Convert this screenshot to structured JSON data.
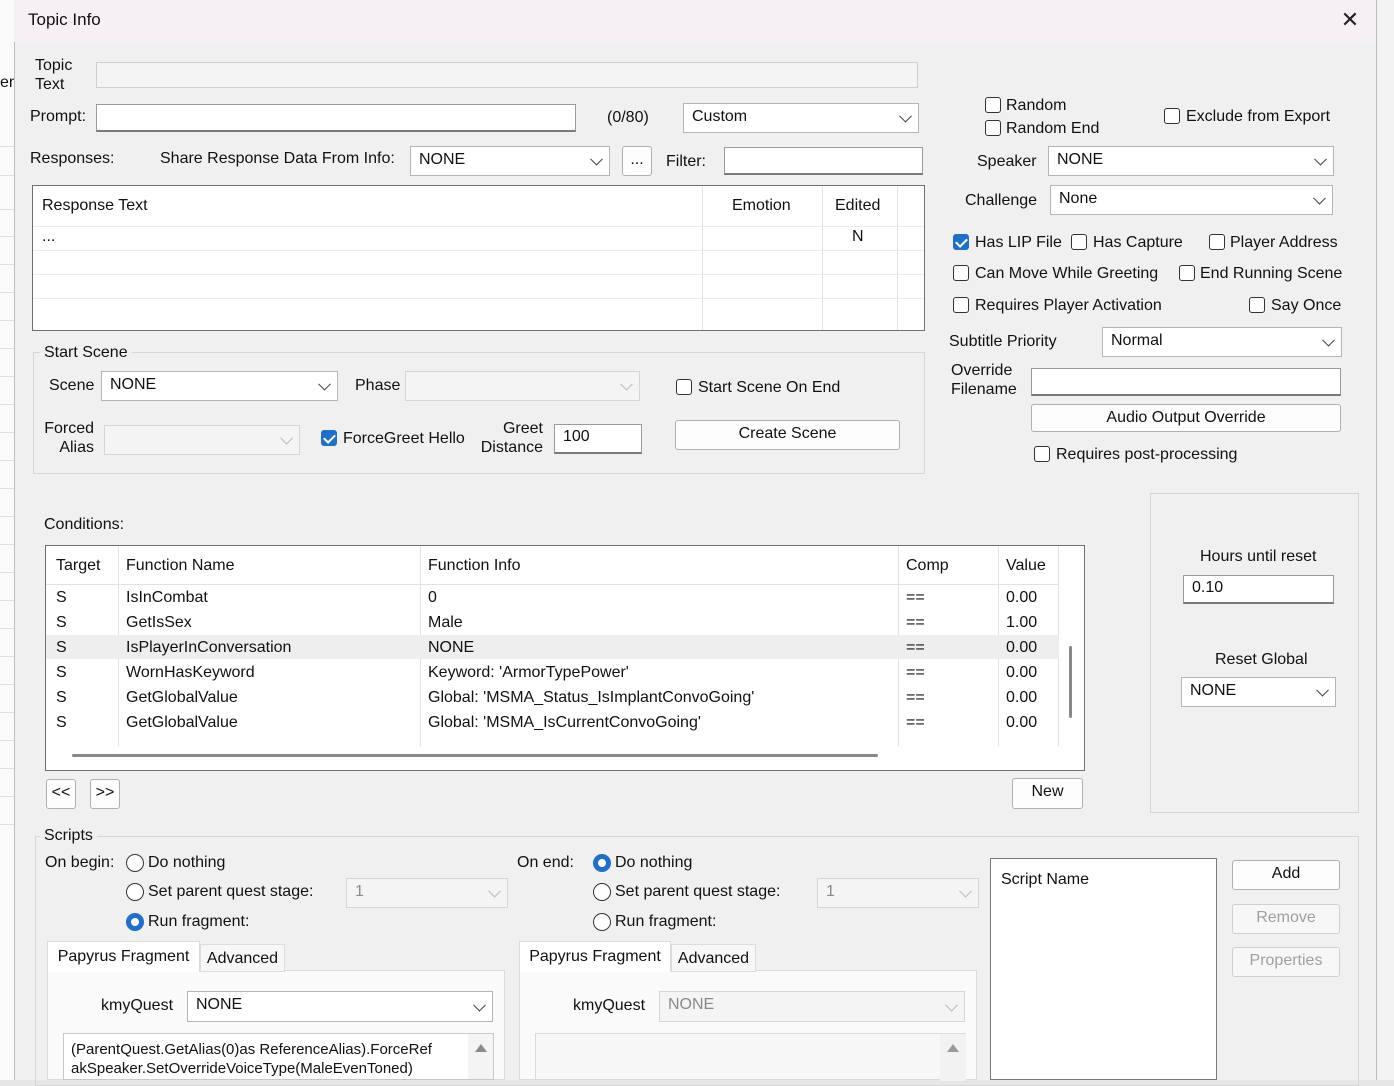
{
  "window": {
    "title": "Topic Info",
    "close_glyph": "✕"
  },
  "bg_sliver_text": "en",
  "topic": {
    "label_line1": "Topic",
    "label_line2": "Text",
    "value": ""
  },
  "prompt": {
    "label": "Prompt:",
    "value": "",
    "counter": "(0/80)",
    "type_value": "Custom"
  },
  "responses": {
    "label": "Responses:",
    "share_label": "Share Response Data From Info:",
    "share_value": "NONE",
    "ellipsis_button": "...",
    "filter_label": "Filter:",
    "filter_value": "",
    "columns": [
      "Response Text",
      "Emotion",
      "Edited"
    ],
    "rows": [
      {
        "text": "...",
        "emotion": "",
        "edited": "N"
      }
    ]
  },
  "flags": {
    "random": "Random",
    "random_end": "Random End",
    "exclude_from_export": "Exclude from Export",
    "speaker_label": "Speaker",
    "speaker_value": "NONE",
    "challenge_label": "Challenge",
    "challenge_value": "None",
    "has_lip_file": "Has LIP File",
    "has_capture": "Has Capture",
    "player_address": "Player Address",
    "can_move_while_greeting": "Can Move While Greeting",
    "end_running_scene": "End Running Scene",
    "requires_player_activation": "Requires Player Activation",
    "say_once": "Say Once",
    "subtitle_priority_label": "Subtitle Priority",
    "subtitle_priority_value": "Normal",
    "override_label_line1": "Override",
    "override_label_line2": "Filename",
    "override_value": "",
    "audio_output_override": "Audio Output Override",
    "requires_post_processing": "Requires post-processing"
  },
  "start_scene": {
    "group_label": "Start Scene",
    "scene_label": "Scene",
    "scene_value": "NONE",
    "phase_label": "Phase",
    "phase_value": "",
    "start_on_end": "Start Scene On End",
    "forced_label_line1": "Forced",
    "forced_label_line2": "Alias",
    "forced_value": "",
    "forcegreet_hello": "ForceGreet Hello",
    "greet_label_line1": "Greet",
    "greet_label_line2": "Distance",
    "greet_value": "100",
    "create_scene": "Create Scene"
  },
  "conditions": {
    "label": "Conditions:",
    "columns": [
      "Target",
      "Function Name",
      "Function Info",
      "Comp",
      "Value"
    ],
    "rows": [
      {
        "target": "S",
        "function": "IsInCombat",
        "info": "0",
        "comp": "==",
        "value": "0.00"
      },
      {
        "target": "S",
        "function": "GetIsSex",
        "info": "Male",
        "comp": "==",
        "value": "1.00"
      },
      {
        "target": "S",
        "function": "IsPlayerInConversation",
        "info": "NONE",
        "comp": "==",
        "value": "0.00"
      },
      {
        "target": "S",
        "function": "WornHasKeyword",
        "info": "Keyword: 'ArmorTypePower'",
        "comp": "==",
        "value": "0.00"
      },
      {
        "target": "S",
        "function": "GetGlobalValue",
        "info": "Global: 'MSMA_Status_IsImplantConvoGoing'",
        "comp": "==",
        "value": "0.00"
      },
      {
        "target": "S",
        "function": "GetGlobalValue",
        "info": "Global: 'MSMA_IsCurrentConvoGoing'",
        "comp": "==",
        "value": "0.00"
      }
    ],
    "prev_button": "<<",
    "next_button": ">>",
    "new_button": "New"
  },
  "reset": {
    "hours_label": "Hours until reset",
    "hours_value": "0.10",
    "global_label": "Reset Global",
    "global_value": "NONE"
  },
  "scripts": {
    "group_label": "Scripts",
    "on_begin": {
      "label": "On begin:",
      "do_nothing": "Do nothing",
      "set_stage": "Set parent quest stage:",
      "stage_value": "1",
      "run_fragment": "Run fragment:",
      "tab_papyrus": "Papyrus Fragment",
      "tab_advanced": "Advanced",
      "quest_label": "kmyQuest",
      "quest_value": "NONE",
      "code_line1": "(ParentQuest.GetAlias(0)as ReferenceAlias).ForceRef",
      "code_line2": "akSpeaker.SetOverrideVoiceType(MaleEvenToned)"
    },
    "on_end": {
      "label": "On end:",
      "do_nothing": "Do nothing",
      "set_stage": "Set parent quest stage:",
      "stage_value": "1",
      "run_fragment": "Run fragment:",
      "tab_papyrus": "Papyrus Fragment",
      "tab_advanced": "Advanced",
      "quest_label": "kmyQuest",
      "quest_value": "NONE"
    },
    "list_header": "Script Name",
    "add_button": "Add",
    "remove_button": "Remove",
    "properties_button": "Properties"
  },
  "colors": {
    "accent": "#1f6fcc",
    "titlebar": "#f6eff4",
    "dialog_bg": "#f0f0f0"
  }
}
